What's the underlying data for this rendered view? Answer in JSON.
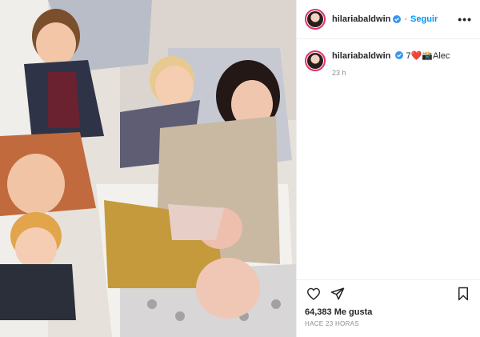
{
  "post": {
    "username": "hilariabaldwin",
    "follow_label": "Seguir",
    "more_label": "•••",
    "caption": {
      "prefix": "7",
      "emoji": "❤️📸",
      "text": "Alec"
    },
    "relative_time": "23 h",
    "likes": "64,383 Me gusta",
    "posted_ago": "HACE 23 HORAS"
  },
  "icons": [
    "heart-icon",
    "share-icon",
    "bookmark-icon",
    "verified-icon",
    "more-icon"
  ],
  "colors": {
    "accent": "#0095f6",
    "text": "#262626",
    "muted": "#8e8e8e"
  }
}
